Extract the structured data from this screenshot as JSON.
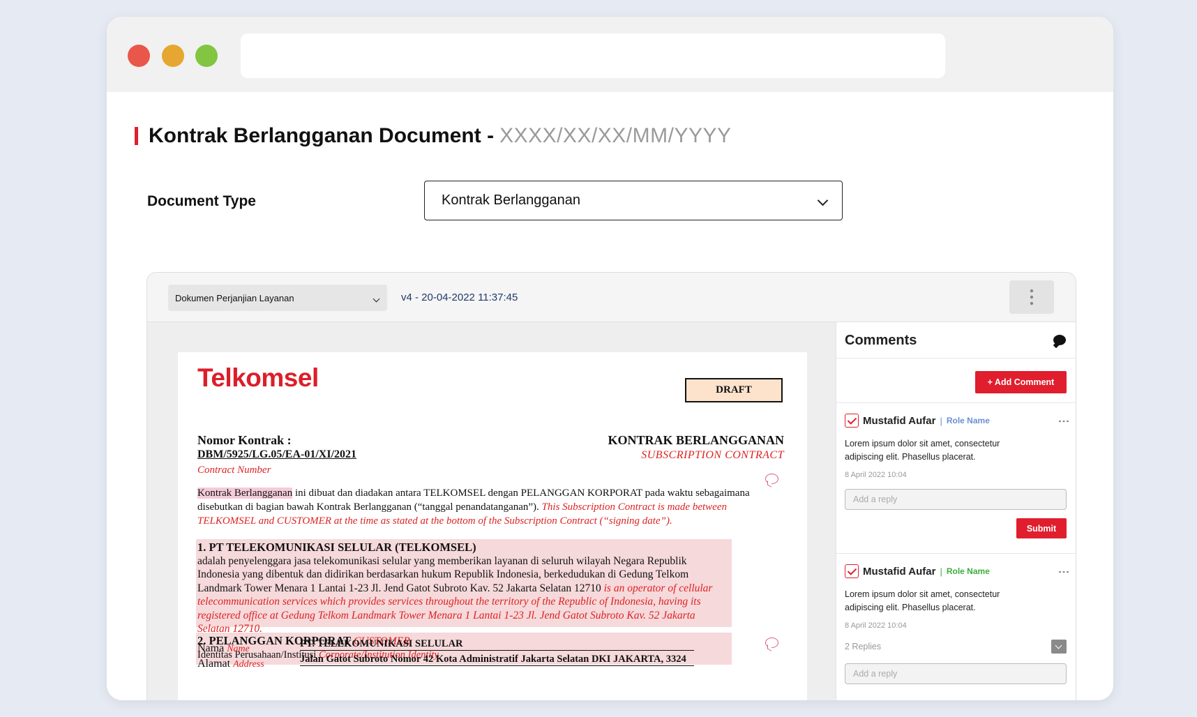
{
  "page": {
    "title": "Kontrak Berlangganan Document -",
    "title_id": "XXXX/XX/XX/MM/YYYY",
    "document_type_label": "Document Type",
    "document_type_value": "Kontrak Berlangganan"
  },
  "viewer": {
    "file_select": "Dokumen Perjanjian Layanan",
    "version": "v4 - 20-04-2022 11:37:45"
  },
  "document": {
    "logo": "Telkomsel",
    "draft": "DRAFT",
    "nomor_label": "Nomor Kontrak :",
    "nomor_value": "DBM/5925/LG.05/EA-01/XI/2021",
    "nomor_en": "Contract Number",
    "kontrak_title": "KONTRAK BERLANGGANAN",
    "kontrak_en": "SUBSCRIPTION CONTRACT",
    "intro_highlight": "Kontrak Berlangganan",
    "intro_text": " ini dibuat dan diadakan antara TELKOMSEL dengan PELANGGAN KORPORAT pada waktu sebagaimana disebutkan di bagian bawah Kontrak Berlangganan (“tanggal penandatanganan”). ",
    "intro_en": "This Subscription Contract is made between TELKOMSEL and CUSTOMER at the time as stated at the bottom of the Subscription Contract (“signing date”).",
    "sec1_head": "1. PT TELEKOMUNIKASI SELULAR (TELKOMSEL)",
    "sec1_text": "adalah penyelenggara jasa telekomunikasi selular yang memberikan layanan di seluruh wilayah Negara Republik Indonesia yang dibentuk dan didirikan berdasarkan hukum Republik Indonesia, berkedudukan di Gedung Telkom Landmark Tower Menara 1 Lantai 1-23 Jl. Jend Gatot Subroto Kav. 52 Jakarta Selatan 12710 ",
    "sec1_en": "is an operator of cellular telecommunication services which provides services throughout the territory of the Republic of Indonesia, having its registered office at Gedung Telkom Landmark Tower Menara 1 Lantai 1-23 Jl. Jend Gatot Subroto Kav. 52 Jakarta Selatan 12710.",
    "sec2_head": "2. PELANGGAN KORPORAT",
    "sec2_head_en": "CUSTOMER",
    "sec2_sub": "Identitas Perusahaan/Institusi",
    "sec2_sub_en": "Corporate/Institution Identity",
    "nama_label": "Nama",
    "nama_en": "Name",
    "nama_value": "PT. TELEKOMUNIKASI SELULAR",
    "alamat_label": "Alamat",
    "alamat_en": "Address",
    "alamat_value": "Jalan Gatot Subroto Nomor 42 Kota Administratif Jakarta Selatan DKI JAKARTA, 3324"
  },
  "comments": {
    "title": "Comments",
    "add_button": "+ Add Comment",
    "items": [
      {
        "author": "Mustafid Aufar",
        "role": "Role Name",
        "role_color": "#6b8fd6",
        "body": "Lorem ipsum dolor sit amet, consectetur adipiscing elit. Phasellus placerat.",
        "time": "8 April 2022 10:04",
        "reply_placeholder": "Add a reply",
        "submit": "Submit"
      },
      {
        "author": "Mustafid Aufar",
        "role": "Role Name",
        "role_color": "#3cae3c",
        "body": "Lorem ipsum dolor sit amet, consectetur adipiscing elit. Phasellus placerat.",
        "time": "8 April 2022 10:04",
        "replies": "2 Replies",
        "reply_placeholder": "Add a reply"
      }
    ]
  },
  "colors": {
    "accent": "#e01e2d",
    "highlight": "#f6d9db"
  },
  "icons": {
    "chevron": "chevron-down-icon",
    "kebab": "more-vertical-icon",
    "chat": "chat-bubble-icon",
    "check": "checkbox-checked-icon"
  }
}
